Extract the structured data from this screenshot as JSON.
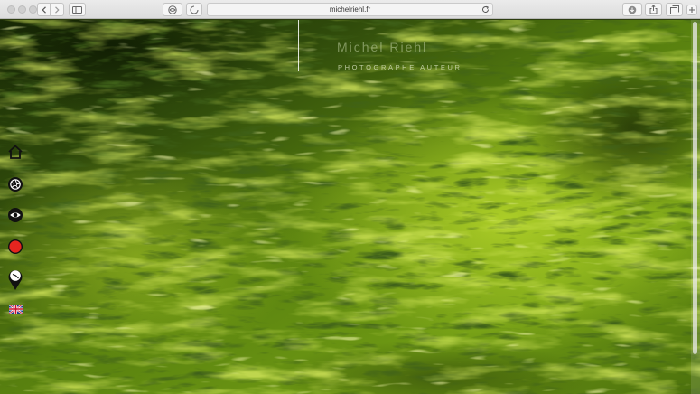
{
  "browser": {
    "url": "michelriehl.fr"
  },
  "site": {
    "title": "Michel Riehl",
    "subtitle": "PHOTOGRAPHE AUTEUR"
  },
  "colors": {
    "record": "#e5251f",
    "water_dark": "#1d3208",
    "water_light": "#9cc21d"
  },
  "nav": {
    "items": [
      {
        "id": "home",
        "icon": "home-icon"
      },
      {
        "id": "portfolio",
        "icon": "aperture-icon"
      },
      {
        "id": "view",
        "icon": "eye-icon"
      },
      {
        "id": "record",
        "icon": "record-icon"
      },
      {
        "id": "location",
        "icon": "location-pin-icon"
      },
      {
        "id": "language",
        "icon": "uk-flag-icon"
      }
    ]
  }
}
